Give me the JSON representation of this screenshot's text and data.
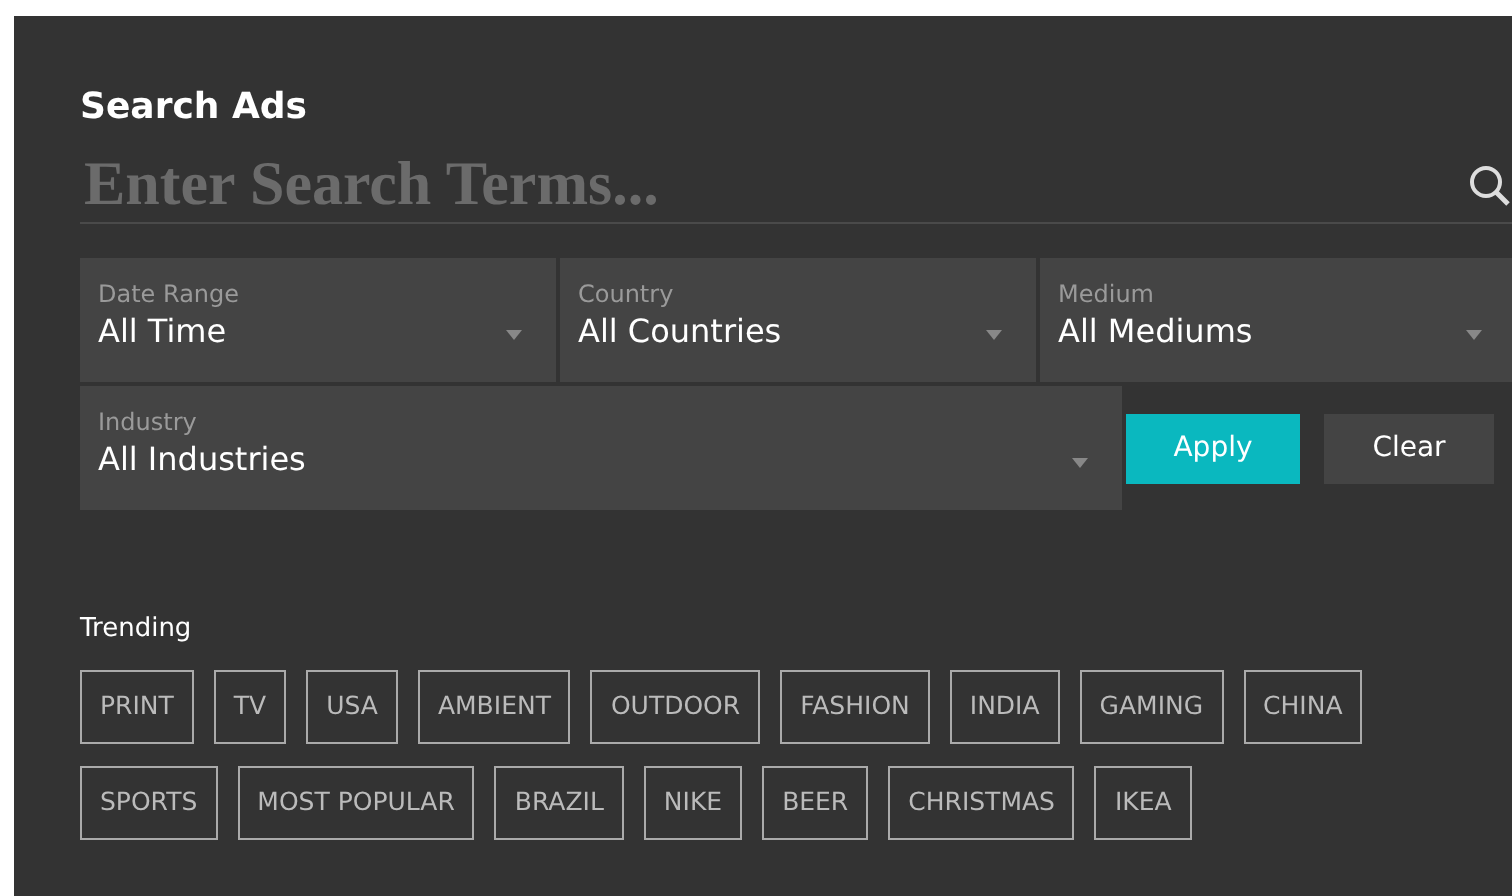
{
  "title": "Search Ads",
  "search": {
    "placeholder": "Enter Search Terms..."
  },
  "filters": [
    {
      "label": "Date Range",
      "value": "All Time"
    },
    {
      "label": "Country",
      "value": "All Countries"
    },
    {
      "label": "Medium",
      "value": "All Mediums"
    },
    {
      "label": "Industry",
      "value": "All Industries"
    }
  ],
  "buttons": [
    {
      "label": "Apply",
      "kind": "primary"
    },
    {
      "label": "Clear",
      "kind": "secondary"
    }
  ],
  "trending": {
    "title": "Trending",
    "tags": [
      "PRINT",
      "TV",
      "USA",
      "AMBIENT",
      "OUTDOOR",
      "FASHION",
      "INDIA",
      "GAMING",
      "CHINA",
      "SPORTS",
      "MOST POPULAR",
      "BRAZIL",
      "NIKE",
      "BEER",
      "CHRISTMAS",
      "IKEA"
    ]
  }
}
